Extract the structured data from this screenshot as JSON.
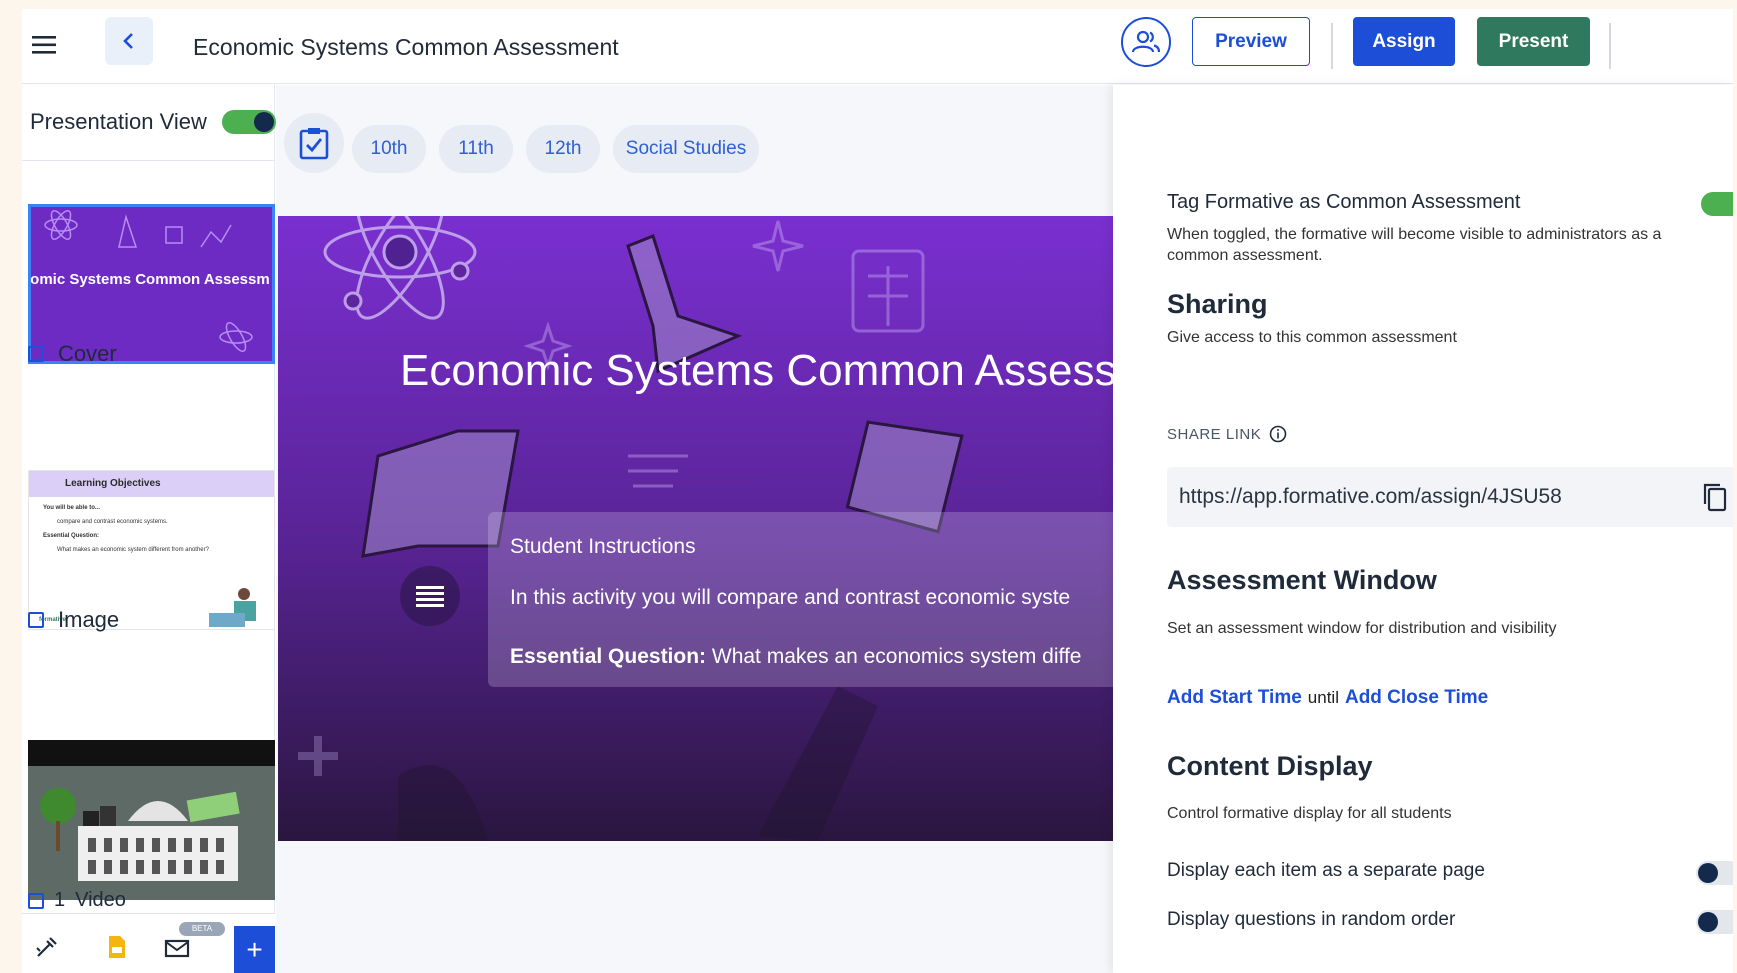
{
  "header": {
    "title": "Economic Systems Common Assessment",
    "preview_label": "Preview",
    "assign_label": "Assign",
    "present_label": "Present"
  },
  "sidebar": {
    "presentation_view_label": "Presentation View",
    "presentation_view_on": true,
    "slides": [
      {
        "label": "Cover",
        "thumb_title": "nomic Systems Common Assessm"
      },
      {
        "label": "Image",
        "thumb_title": "Learning Objectives",
        "thumb_lines": [
          "You will be able to...",
          "compare and contrast economic systems.",
          "Essential Question:",
          "What makes an economic system different from another?",
          "formative"
        ]
      },
      {
        "label": "Video",
        "number": "1"
      }
    ],
    "beta_badge": "BETA",
    "add_label": "+"
  },
  "tags": [
    "10th",
    "11th",
    "12th",
    "Social Studies"
  ],
  "slide": {
    "title": "Economic Systems Common Assess",
    "instructions_heading": "Student Instructions",
    "instructions_text": "In this activity you will compare and contrast economic syste",
    "essential_label": "Essential Question:",
    "essential_text": " What makes an economics system diffe"
  },
  "panel": {
    "tag_formative_label": "Tag Formative as Common Assessment",
    "tag_formative_on": true,
    "tag_formative_desc_1": "When toggled, the formative will become visible to administrators as a",
    "tag_formative_desc_2": "common assessment.",
    "sharing_title": "Sharing",
    "sharing_desc": "Give access to this common assessment",
    "share_link_label": "SHARE LINK",
    "share_link_url": "https://app.formative.com/assign/4JSU58",
    "window_title": "Assessment Window",
    "window_desc": "Set an assessment window for distribution and visibility",
    "add_start": "Add Start Time",
    "until": "until",
    "add_close": "Add Close Time",
    "content_title": "Content Display",
    "content_desc": "Control formative display for all students",
    "separate_page_label": "Display each item as a separate page",
    "separate_page_on": false,
    "random_order_label": "Display questions in random order",
    "random_order_on": false
  },
  "colors": {
    "accent": "#1d4ed8",
    "present": "#2f7a5e",
    "toggle_on": "#4caf50",
    "slide": "#6d2bc4"
  }
}
